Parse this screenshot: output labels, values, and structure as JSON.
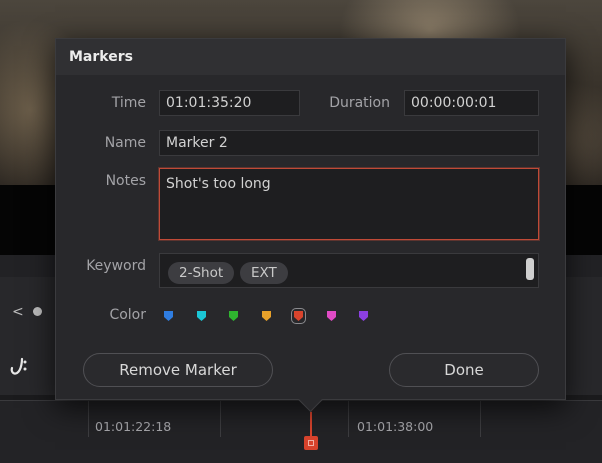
{
  "dialog": {
    "title": "Markers",
    "time_label": "Time",
    "time_value": "01:01:35:20",
    "duration_label": "Duration",
    "duration_value": "00:00:00:01",
    "name_label": "Name",
    "name_value": "Marker 2",
    "notes_label": "Notes",
    "notes_value": "Shot's too long",
    "keyword_label": "Keyword",
    "keywords": [
      "2-Shot",
      "EXT"
    ],
    "color_label": "Color",
    "colors": [
      {
        "name": "blue",
        "hex": "#2f7de1"
      },
      {
        "name": "cyan",
        "hex": "#1bc6d6"
      },
      {
        "name": "green",
        "hex": "#2fb52f"
      },
      {
        "name": "yellow",
        "hex": "#e8a12a"
      },
      {
        "name": "red",
        "hex": "#d9442d",
        "selected": true
      },
      {
        "name": "pink",
        "hex": "#e04bc5"
      },
      {
        "name": "purple",
        "hex": "#8b3fe0"
      }
    ],
    "remove_button": "Remove Marker",
    "done_button": "Done"
  },
  "timeline": {
    "timecodes": [
      "01:01:22:18",
      "01:01:38:00"
    ],
    "nav_prev": "<"
  },
  "accent_color": "#d9442d"
}
